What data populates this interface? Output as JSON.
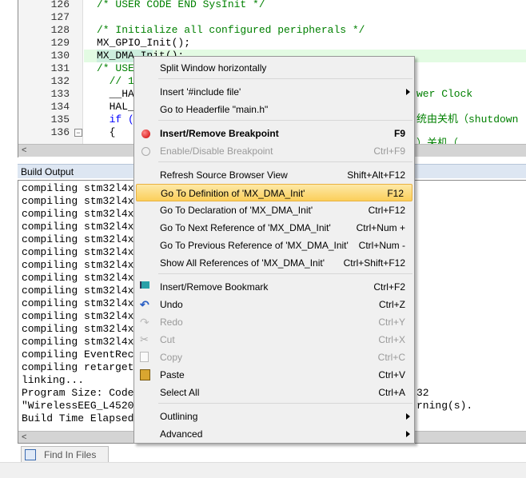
{
  "editor": {
    "line_numbers": [
      "126",
      "127",
      "128",
      "129",
      "130",
      "131",
      "132",
      "133",
      "134",
      "135",
      "136"
    ],
    "lines": [
      {
        "text": "/* USER CODE END SysInit */",
        "cls": "cm"
      },
      {
        "text": "",
        "cls": ""
      },
      {
        "text": "/* Initialize all configured peripherals */",
        "cls": "cm"
      },
      {
        "text": "MX_GPIO_Init();",
        "cls": ""
      },
      {
        "text": "MX_DMA_Init();",
        "cls": ""
      },
      {
        "text": "/* USE",
        "cls": "cm"
      },
      {
        "text": "  // 1",
        "cls": "cm"
      },
      {
        "text": "  __HA",
        "cls": ""
      },
      {
        "text": "  HAL_",
        "cls": ""
      },
      {
        "text": "  if (",
        "cls": "kw"
      },
      {
        "text": "  {",
        "cls": ""
      }
    ],
    "right_fragments": {
      "l133": "wer Clock",
      "l135": "统由关机（shutdown",
      "l137": "）关机（"
    }
  },
  "build_output": {
    "title": "Build Output",
    "lines": [
      "compiling stm32l4x",
      "compiling stm32l4x",
      "compiling stm32l4x",
      "compiling stm32l4x",
      "compiling stm32l4x",
      "compiling stm32l4x",
      "compiling stm32l4x",
      "compiling stm32l4x",
      "compiling stm32l4x",
      "compiling stm32l4x",
      "compiling stm32l4x",
      "compiling stm32l4x",
      "compiling stm32l4x",
      "compiling EventRec",
      "compiling retarget",
      "linking...",
      "Program Size: Code",
      "\"WirelessEEG_L4520",
      "Build Time Elapsed"
    ],
    "right_fragments": {
      "program_size": "32",
      "warnings": "rning(s)."
    }
  },
  "tabs": {
    "find_in_files": "Find In Files"
  },
  "context_menu": {
    "split": "Split Window horizontally",
    "include": "Insert '#include file'",
    "header": "Go to Headerfile \"main.h\"",
    "breakpoint": {
      "label": "Insert/Remove Breakpoint",
      "shortcut": "F9"
    },
    "enable_bp": {
      "label": "Enable/Disable Breakpoint",
      "shortcut": "Ctrl+F9"
    },
    "refresh": {
      "label": "Refresh Source Browser View",
      "shortcut": "Shift+Alt+F12"
    },
    "definition": {
      "label": "Go To Definition of 'MX_DMA_Init'",
      "shortcut": "F12"
    },
    "declaration": {
      "label": "Go To Declaration of 'MX_DMA_Init'",
      "shortcut": "Ctrl+F12"
    },
    "next_ref": {
      "label": "Go To Next Reference of 'MX_DMA_Init'",
      "shortcut": "Ctrl+Num +"
    },
    "prev_ref": {
      "label": "Go To Previous Reference of 'MX_DMA_Init'",
      "shortcut": "Ctrl+Num -"
    },
    "all_refs": {
      "label": "Show All References of 'MX_DMA_Init'",
      "shortcut": "Ctrl+Shift+F12"
    },
    "bookmark": {
      "label": "Insert/Remove Bookmark",
      "shortcut": "Ctrl+F2"
    },
    "undo": {
      "label": "Undo",
      "shortcut": "Ctrl+Z"
    },
    "redo": {
      "label": "Redo",
      "shortcut": "Ctrl+Y"
    },
    "cut": {
      "label": "Cut",
      "shortcut": "Ctrl+X"
    },
    "copy": {
      "label": "Copy",
      "shortcut": "Ctrl+C"
    },
    "paste": {
      "label": "Paste",
      "shortcut": "Ctrl+V"
    },
    "select_all": {
      "label": "Select All",
      "shortcut": "Ctrl+A"
    },
    "outlining": "Outlining",
    "advanced": "Advanced"
  },
  "colors": {
    "highlight": "#fbcf5a",
    "comment": "#008000",
    "keyword": "#0000ff",
    "current_line": "#e3fbe3"
  }
}
